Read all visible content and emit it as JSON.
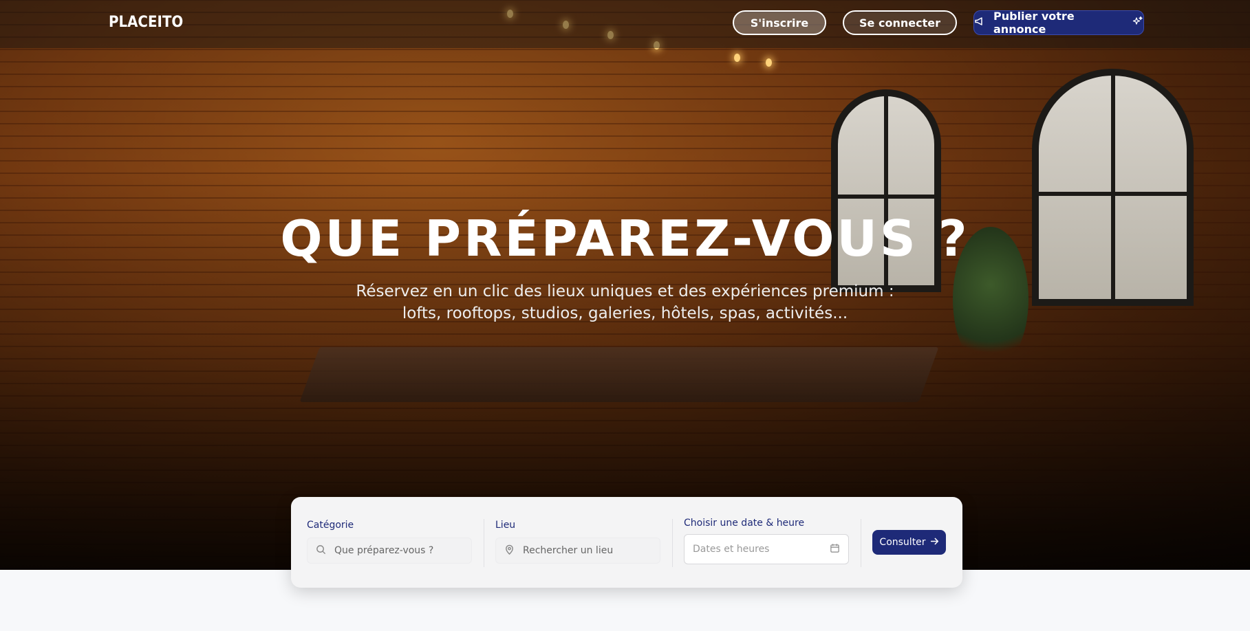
{
  "header": {
    "logo": "PLACEITO",
    "signup_label": "S'inscrire",
    "login_label": "Se connecter",
    "publish_label": "Publier votre annonce"
  },
  "hero": {
    "title": "QUE PRÉPAREZ-VOUS ?",
    "subtitle_line1": "Réservez en un clic des lieux uniques et des expériences premium :",
    "subtitle_line2": "lofts, rooftops, studios, galeries, hôtels, spas, activités..."
  },
  "search": {
    "category_label": "Catégorie",
    "category_placeholder": "Que préparez-vous ?",
    "location_label": "Lieu",
    "location_placeholder": "Rechercher un lieu",
    "date_label": "Choisir une date & heure",
    "date_placeholder": "Dates et heures",
    "submit_label": "Consulter"
  },
  "colors": {
    "brand": "#1e2a78",
    "page_bg": "#f7f8fa"
  },
  "icons": {
    "publish_left": "megaphone-icon",
    "publish_right": "sparkle-icon",
    "category": "search-icon",
    "location": "map-pin-icon",
    "date": "calendar-icon",
    "submit": "arrow-right-icon"
  }
}
